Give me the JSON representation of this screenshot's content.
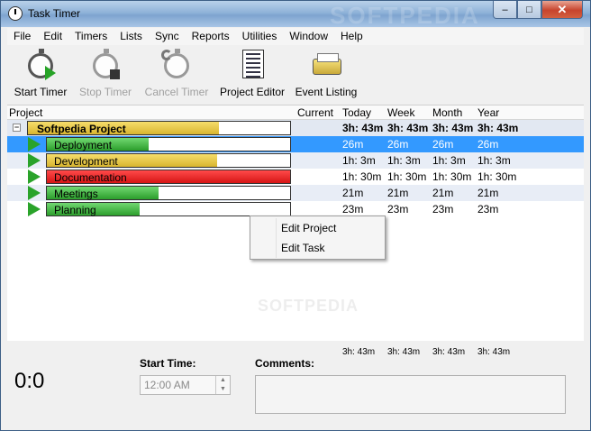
{
  "window": {
    "title": "Task Timer",
    "watermark": "SOFTPEDIA"
  },
  "window_controls": {
    "minimize": "–",
    "maximize": "□",
    "close": "✕"
  },
  "menu": [
    "File",
    "Edit",
    "Timers",
    "Lists",
    "Sync",
    "Reports",
    "Utilities",
    "Window",
    "Help"
  ],
  "toolbar": {
    "start_timer": "Start Timer",
    "stop_timer": "Stop Timer",
    "cancel_timer": "Cancel Timer",
    "project_editor": "Project Editor",
    "event_listing": "Event Listing"
  },
  "grid": {
    "headers": {
      "project": "Project",
      "current": "Current",
      "today": "Today",
      "week": "Week",
      "month": "Month",
      "year": "Year"
    },
    "project": {
      "name": "Softpedia Project",
      "expander": "−",
      "current": "",
      "today": "3h: 43m",
      "week": "3h: 43m",
      "month": "3h: 43m",
      "year": "3h: 43m",
      "progress": 0.73,
      "color": "#e0c040"
    },
    "tasks": [
      {
        "name": "Deployment",
        "today": "26m",
        "week": "26m",
        "month": "26m",
        "year": "26m",
        "progress": 0.42,
        "color": "green",
        "selected": true
      },
      {
        "name": "Development",
        "today": "1h: 3m",
        "week": "1h: 3m",
        "month": "1h: 3m",
        "year": "1h: 3m",
        "progress": 0.7,
        "color": "yellow",
        "selected": false
      },
      {
        "name": "Documentation",
        "today": "1h: 30m",
        "week": "1h: 30m",
        "month": "1h: 30m",
        "year": "1h: 30m",
        "progress": 1.0,
        "color": "red",
        "selected": false
      },
      {
        "name": "Meetings",
        "today": "21m",
        "week": "21m",
        "month": "21m",
        "year": "21m",
        "progress": 0.46,
        "color": "green",
        "selected": false
      },
      {
        "name": "Planning",
        "today": "23m",
        "week": "23m",
        "month": "23m",
        "year": "23m",
        "progress": 0.38,
        "color": "green",
        "selected": false
      }
    ]
  },
  "context_menu": {
    "edit_project": "Edit Project",
    "edit_task": "Edit Task"
  },
  "totals": {
    "today": "3h: 43m",
    "week": "3h: 43m",
    "month": "3h: 43m",
    "year": "3h: 43m"
  },
  "bottom": {
    "timer": "0:0",
    "start_time_label": "Start Time:",
    "start_time_value": "12:00 AM",
    "comments_label": "Comments:",
    "comments_value": ""
  }
}
